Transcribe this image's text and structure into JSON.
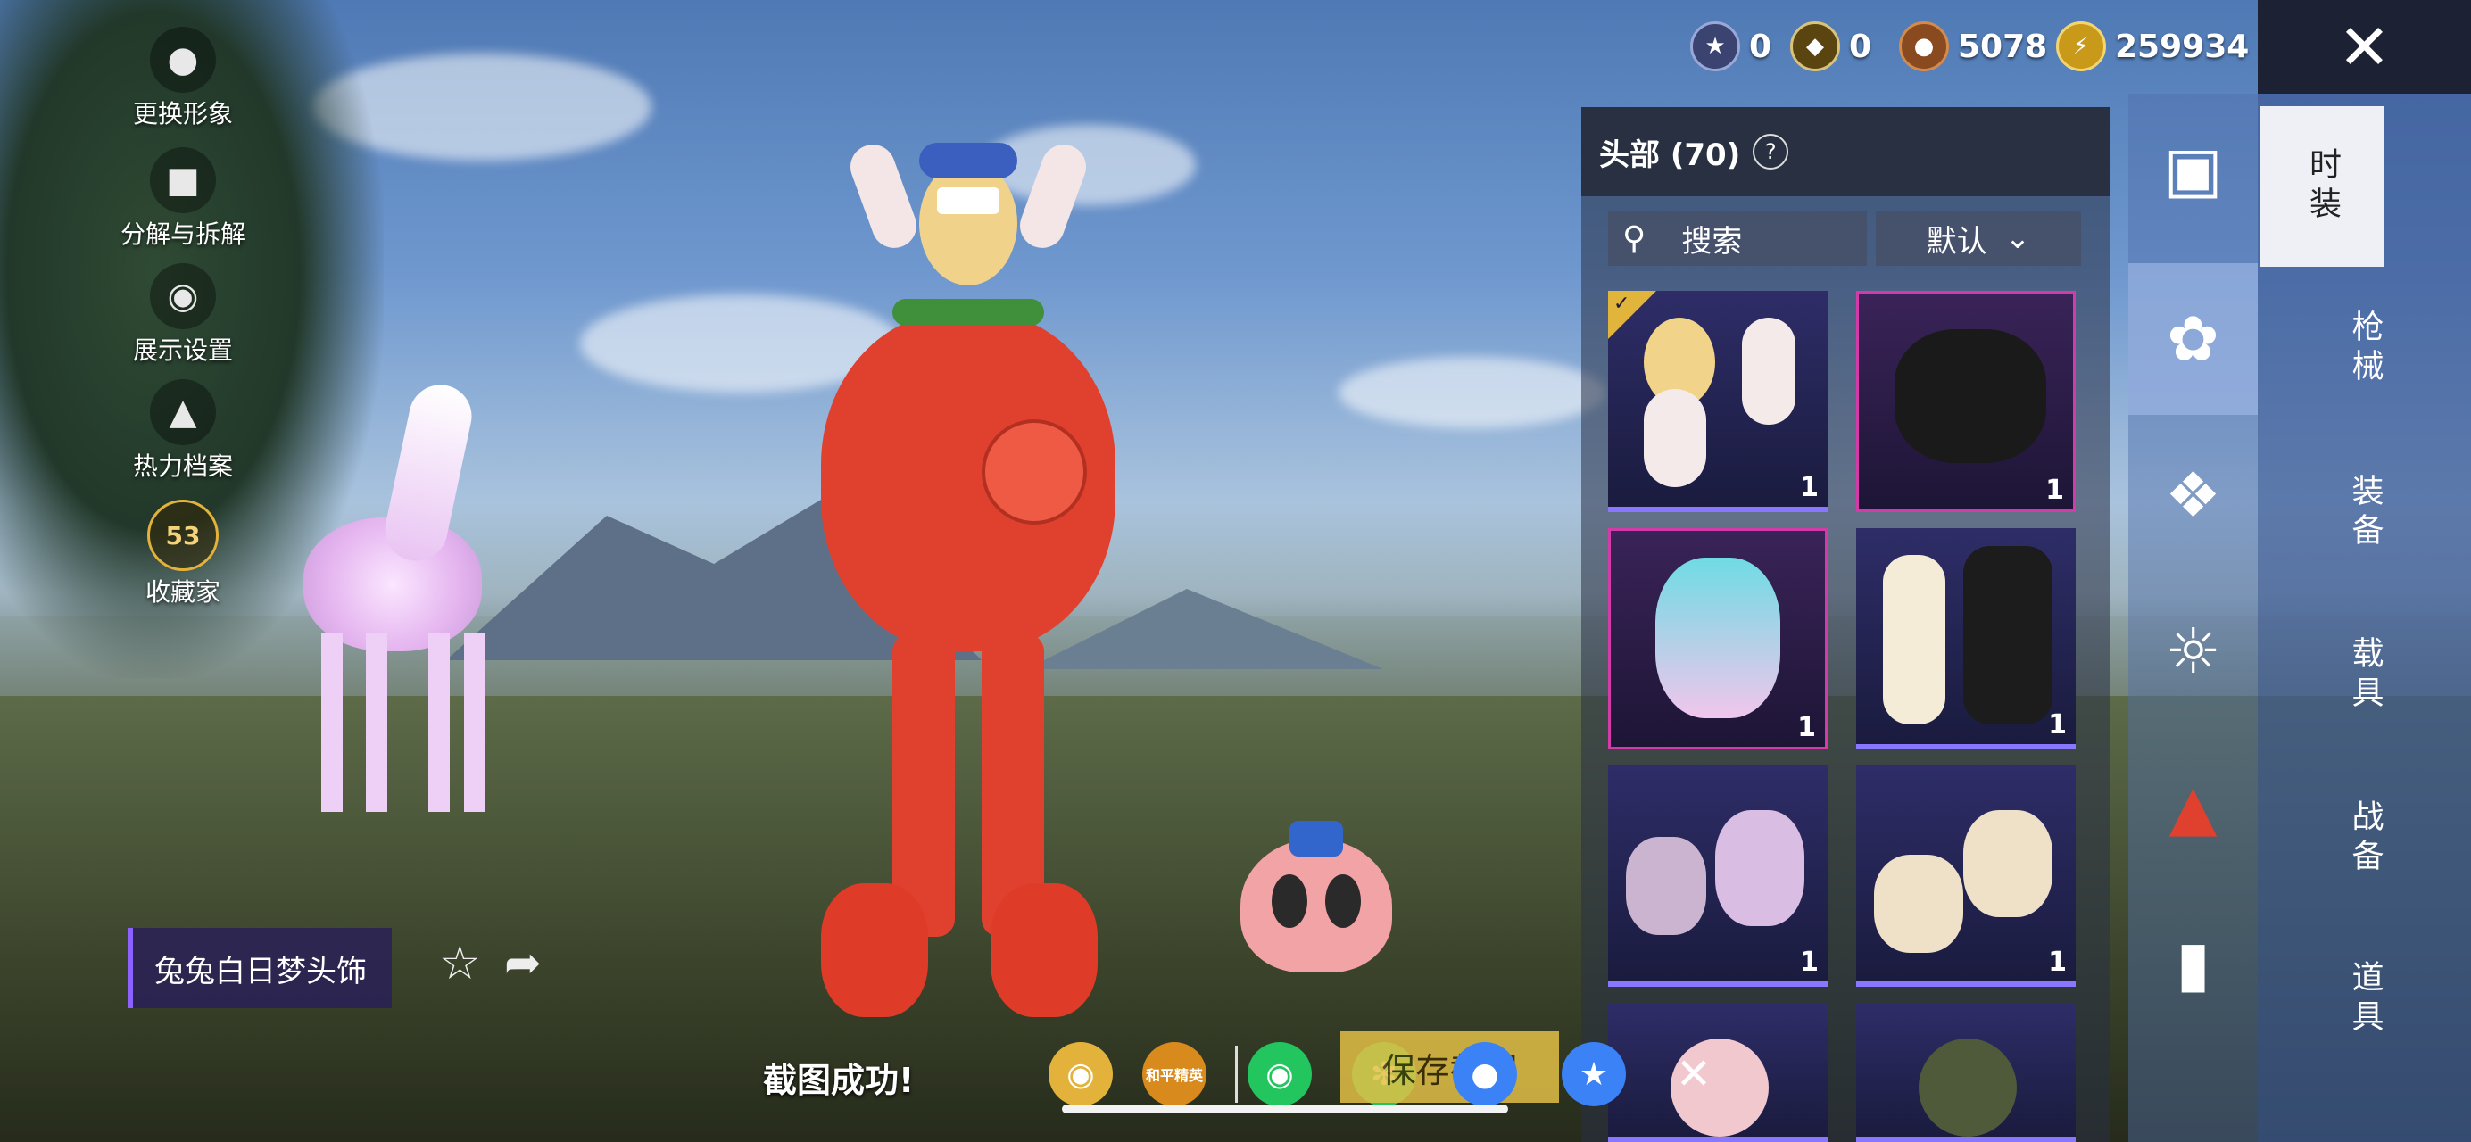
{
  "left_menu": [
    {
      "label": "更换形象",
      "icon": "person-icon"
    },
    {
      "label": "分解与拆解",
      "icon": "puzzle-icon"
    },
    {
      "label": "展示设置",
      "icon": "eye-icon"
    },
    {
      "label": "热力档案",
      "icon": "flame-icon"
    },
    {
      "label": "收藏家",
      "icon": "collector-badge-icon",
      "badge": "53"
    }
  ],
  "currency": [
    {
      "icon": "medal-icon",
      "value": "0"
    },
    {
      "icon": "token-icon",
      "value": "0"
    },
    {
      "icon": "bronze-coin-icon",
      "value": "5078"
    },
    {
      "icon": "lightning-coin-icon",
      "value": "259934"
    }
  ],
  "panel": {
    "title": "头部 (70)",
    "search_label": "搜索",
    "sort_label": "默认",
    "items": [
      {
        "count": "1",
        "rarity": "blue",
        "equipped": true,
        "art": "bunny-ears-headpiece"
      },
      {
        "count": "1",
        "rarity": "pink",
        "equipped": false,
        "art": "black-hair"
      },
      {
        "count": "1",
        "rarity": "pink",
        "equipped": false,
        "art": "teal-twintails"
      },
      {
        "count": "1",
        "rarity": "blue",
        "equipped": false,
        "art": "white-black-hair"
      },
      {
        "count": "1",
        "rarity": "blue",
        "equipped": false,
        "art": "lavender-hair"
      },
      {
        "count": "1",
        "rarity": "blue",
        "equipped": false,
        "art": "bunny-bob-hair"
      }
    ]
  },
  "categories": [
    {
      "icon": "wardrobe-icon"
    },
    {
      "icon": "bunny-head-icon",
      "active": true
    },
    {
      "icon": "bandage-icon"
    },
    {
      "icon": "mask-icon"
    },
    {
      "icon": "outfit-icon"
    },
    {
      "icon": "pants-icon"
    }
  ],
  "tabs": [
    {
      "label": "时装",
      "active": true
    },
    {
      "label": "枪械"
    },
    {
      "label": "装备"
    },
    {
      "label": "载具"
    },
    {
      "label": "战备"
    },
    {
      "label": "道具"
    }
  ],
  "item_name": "兔兔白日梦头饰",
  "toast": "截图成功!",
  "share_targets": [
    {
      "icon": "game-center-icon",
      "label": "",
      "color": "#e2b23a"
    },
    {
      "icon": "peace-elite-icon",
      "label": "和平精英",
      "color": "#d98a1c"
    },
    {
      "icon": "wechat-icon",
      "label": "",
      "color": "#22c55e"
    },
    {
      "icon": "moments-icon",
      "label": "",
      "color": "#22c55e"
    },
    {
      "icon": "qq-icon",
      "label": "",
      "color": "#3b82f6"
    },
    {
      "icon": "qzone-icon",
      "label": "",
      "color": "#3b82f6"
    }
  ],
  "save_button_label": "保存截图",
  "close_symbol": "✕"
}
